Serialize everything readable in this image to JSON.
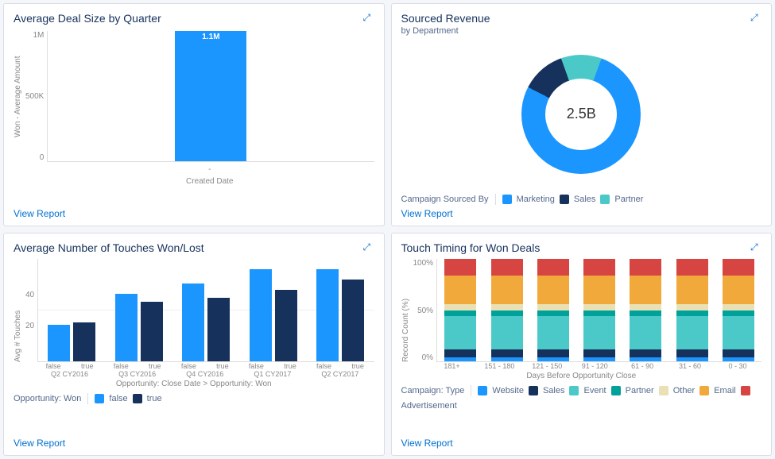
{
  "card1": {
    "title": "Average Deal Size by Quarter",
    "ylabel": "Won - Average Amount",
    "xlabel": "Created Date",
    "yticks": [
      "1M",
      "500K",
      "0"
    ],
    "bar_label": "1.1M",
    "view_report": "View Report"
  },
  "card2": {
    "title": "Sourced Revenue",
    "subtitle": "by Department",
    "center_value": "2.5B",
    "legend_title": "Campaign Sourced By",
    "legend": [
      {
        "label": "Marketing",
        "color": "#1b96ff"
      },
      {
        "label": "Sales",
        "color": "#16325c"
      },
      {
        "label": "Partner",
        "color": "#4bc9c9"
      }
    ],
    "view_report": "View Report"
  },
  "card3": {
    "title": "Average Number of Touches Won/Lost",
    "ylabel": "Avg # Touches",
    "yticks": [
      "40",
      "20"
    ],
    "xlabel": "Opportunity: Close Date > Opportunity: Won",
    "legend_title": "Opportunity: Won",
    "legend": [
      {
        "label": "false",
        "color": "#1b96ff"
      },
      {
        "label": "true",
        "color": "#16325c"
      }
    ],
    "view_report": "View Report",
    "sub_tick_false": "false",
    "sub_tick_true": "true"
  },
  "card4": {
    "title": "Touch Timing for Won Deals",
    "ylabel": "Record Count (%)",
    "xlabel": "Days Before Opportunity Close",
    "yticks": [
      "100%",
      "50%",
      "0%"
    ],
    "legend_title": "Campaign: Type",
    "legend": [
      {
        "label": "Website",
        "color": "#1b96ff"
      },
      {
        "label": "Sales",
        "color": "#16325c"
      },
      {
        "label": "Event",
        "color": "#4bc9c9"
      },
      {
        "label": "Partner",
        "color": "#00a19a"
      },
      {
        "label": "Other",
        "color": "#e9e0b4"
      },
      {
        "label": "Email",
        "color": "#f2a93b"
      },
      {
        "label": "Advertisement",
        "color": "#d64541"
      }
    ],
    "view_report": "View Report"
  },
  "chart_data": [
    {
      "id": "card1",
      "type": "bar",
      "title": "Average Deal Size by Quarter",
      "ylabel": "Won - Average Amount",
      "xlabel": "Created Date",
      "ylim": [
        0,
        1100000
      ],
      "categories": [
        "-"
      ],
      "values": [
        1100000
      ],
      "value_labels": [
        "1.1M"
      ]
    },
    {
      "id": "card2",
      "type": "pie",
      "title": "Sourced Revenue by Department",
      "total_label": "2.5B",
      "total_value": 2500000000,
      "series": [
        {
          "name": "Marketing",
          "value": 77,
          "color": "#1b96ff"
        },
        {
          "name": "Sales",
          "value": 12,
          "color": "#16325c"
        },
        {
          "name": "Partner",
          "value": 11,
          "color": "#4bc9c9"
        }
      ],
      "unit": "percent_of_total"
    },
    {
      "id": "card3",
      "type": "bar",
      "title": "Average Number of Touches Won/Lost",
      "ylabel": "Avg # Touches",
      "xlabel": "Opportunity: Close Date > Opportunity: Won",
      "ylim": [
        0,
        50
      ],
      "categories": [
        "Q2 CY2016",
        "Q3 CY2016",
        "Q4 CY2016",
        "Q1 CY2017",
        "Q2 CY2017"
      ],
      "series": [
        {
          "name": "false",
          "color": "#1b96ff",
          "values": [
            18,
            33,
            38,
            45,
            45
          ]
        },
        {
          "name": "true",
          "color": "#16325c",
          "values": [
            19,
            29,
            31,
            35,
            40
          ]
        }
      ]
    },
    {
      "id": "card4",
      "type": "bar_stacked_100",
      "title": "Touch Timing for Won Deals",
      "ylabel": "Record Count (%)",
      "xlabel": "Days Before Opportunity Close",
      "ylim": [
        0,
        100
      ],
      "categories": [
        "181+",
        "151 - 180",
        "121 - 150",
        "91 - 120",
        "61 - 90",
        "31 - 60",
        "0 - 30"
      ],
      "series": [
        {
          "name": "Website",
          "color": "#1b96ff",
          "values": [
            4,
            4,
            4,
            4,
            4,
            4,
            4
          ]
        },
        {
          "name": "Sales",
          "color": "#16325c",
          "values": [
            8,
            8,
            8,
            8,
            8,
            8,
            8
          ]
        },
        {
          "name": "Event",
          "color": "#4bc9c9",
          "values": [
            32,
            32,
            32,
            32,
            32,
            32,
            32
          ]
        },
        {
          "name": "Partner",
          "color": "#00a19a",
          "values": [
            6,
            6,
            6,
            6,
            6,
            6,
            6
          ]
        },
        {
          "name": "Other",
          "color": "#e9e0b4",
          "values": [
            6,
            6,
            6,
            6,
            6,
            6,
            6
          ]
        },
        {
          "name": "Email",
          "color": "#f2a93b",
          "values": [
            28,
            28,
            28,
            28,
            28,
            28,
            28
          ]
        },
        {
          "name": "Advertisement",
          "color": "#d64541",
          "values": [
            16,
            16,
            16,
            16,
            16,
            16,
            16
          ]
        }
      ]
    }
  ]
}
